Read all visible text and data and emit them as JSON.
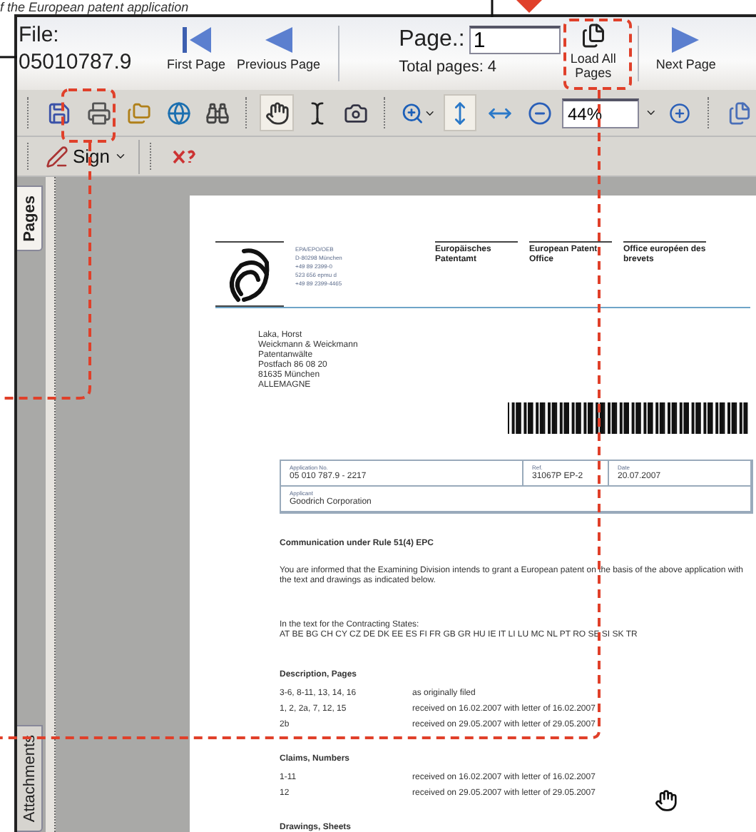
{
  "caption": "f the European patent application",
  "nav": {
    "file_label": "File:",
    "file_number": "05010787.9",
    "buttons": [
      {
        "kind": "first",
        "label": "First Page"
      },
      {
        "kind": "previous",
        "label": "Previous Page"
      }
    ],
    "page_label": "Page.:",
    "page_value": "1",
    "total_label": "Total pages:",
    "total_value": "4",
    "load_all": "Load All Pages",
    "next": "Next Page"
  },
  "toolbar": {
    "tools": [
      {
        "kind": "save",
        "selected": false
      },
      {
        "kind": "print",
        "selected": false
      },
      {
        "kind": "folders",
        "selected": false
      },
      {
        "kind": "globe",
        "selected": false
      },
      {
        "kind": "binoculars",
        "selected": false
      },
      {
        "kind": "hand",
        "selected": true
      },
      {
        "kind": "text",
        "selected": false
      },
      {
        "kind": "camera",
        "selected": false
      },
      {
        "kind": "zoom",
        "selected": false
      },
      {
        "kind": "fit_page",
        "selected": true
      },
      {
        "kind": "fit_width",
        "selected": false
      },
      {
        "kind": "minus",
        "selected": false
      }
    ],
    "zoom_value": "44%"
  },
  "sign": "Sign",
  "side_tabs": [
    {
      "label": "Pages",
      "selected": true
    },
    {
      "label": "Attachments",
      "selected": false
    }
  ],
  "document": {
    "contact": [
      "EPA/EPO/OEB",
      "D-80298 München",
      "+49 89 2399-0",
      "523 656 epmu d",
      "+49 89 2399-4465"
    ],
    "offices": [
      {
        "name": "Europäisches Patentamt"
      },
      {
        "name": "European Patent Office"
      },
      {
        "name": "Office européen des brevets"
      }
    ],
    "address": [
      "Laka, Horst",
      "Weickmann & Weickmann",
      "Patentanwälte",
      "Postfach 86 08 20",
      "81635 München",
      "ALLEMAGNE"
    ],
    "info": [
      {
        "label": "Application No.",
        "value": "05 010 787.9 - 2217"
      },
      {
        "label": "Ref.",
        "value": "31067P EP-2"
      },
      {
        "label": "Date",
        "value": "20.07.2007"
      },
      {
        "label": "Applicant",
        "value": "Goodrich Corporation"
      }
    ],
    "heading": "Communication under Rule 51(4) EPC",
    "paragraph": "You are informed that the Examining Division intends to grant a European patent on the basis of the above application with the text and drawings as indicated below.",
    "states_label": "In the text for the Contracting States:",
    "states": "AT BE BG CH CY CZ DE DK EE ES FI FR GB GR HU IE IT LI LU MC NL PT RO SE SI SK TR",
    "sections": [
      {
        "title": "Description, Pages",
        "rows": [
          {
            "items": "3-6, 8-11, 13, 14, 16",
            "status": "as originally filed"
          },
          {
            "items": "1, 2, 2a, 7, 12, 15",
            "status": "received on 16.02.2007 with letter of 16.02.2007"
          },
          {
            "items": "2b",
            "status": "received on 29.05.2007 with letter of 29.05.2007"
          }
        ]
      },
      {
        "title": "Claims, Numbers",
        "rows": [
          {
            "items": "1-11",
            "status": "received on 16.02.2007 with letter of 16.02.2007"
          },
          {
            "items": "12",
            "status": "received on 29.05.2007 with letter of 29.05.2007"
          }
        ]
      },
      {
        "title": "Drawings, Sheets"
      }
    ]
  }
}
